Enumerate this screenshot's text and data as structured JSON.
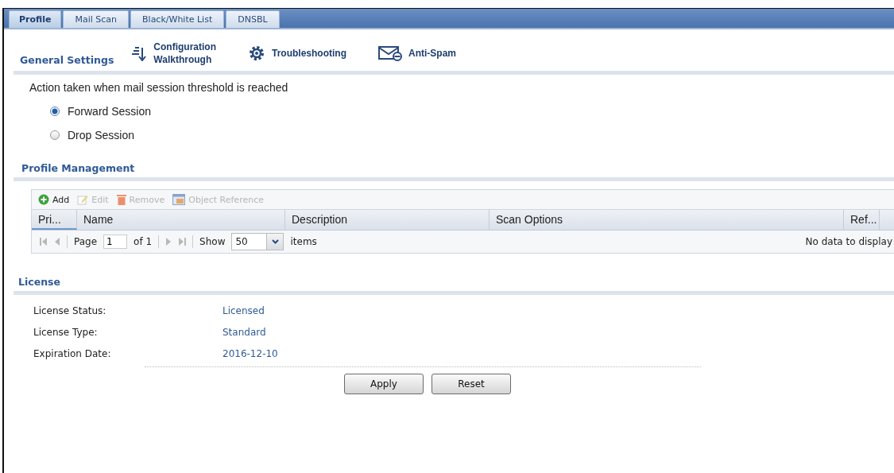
{
  "tabs": [
    {
      "label": "Profile",
      "selected": true
    },
    {
      "label": "Mail Scan",
      "selected": false
    },
    {
      "label": "Black/White List",
      "selected": false
    },
    {
      "label": "DNSBL",
      "selected": false
    }
  ],
  "general_settings": {
    "title": "General Settings",
    "links": [
      {
        "kind": "walkthrough",
        "lines": [
          "Configuration",
          "Walkthrough"
        ]
      },
      {
        "kind": "troubleshooting",
        "lines": [
          "Troubleshooting"
        ]
      },
      {
        "kind": "antispam",
        "lines": [
          "Anti-Spam"
        ]
      }
    ],
    "prompt": "Action taken when mail session threshold is reached",
    "options": [
      {
        "label": "Forward Session",
        "selected": true
      },
      {
        "label": "Drop Session",
        "selected": false
      }
    ]
  },
  "profile_management": {
    "title": "Profile Management",
    "toolbar": [
      {
        "kind": "add",
        "label": "Add",
        "disabled": false
      },
      {
        "kind": "edit",
        "label": "Edit",
        "disabled": true
      },
      {
        "kind": "remove",
        "label": "Remove",
        "disabled": true
      },
      {
        "kind": "reference",
        "label": "Object Reference",
        "disabled": true
      }
    ],
    "columns": [
      "Pri...",
      "Name",
      "Description",
      "Scan Options",
      "Ref..."
    ],
    "pager": {
      "page_label": "Page",
      "page": "1",
      "of": "of 1",
      "show_label": "Show",
      "show": "50",
      "items_label": "items",
      "empty": "No data to display"
    }
  },
  "license": {
    "title": "License",
    "rows": [
      {
        "label": "License Status:",
        "value": "Licensed"
      },
      {
        "label": "License Type:",
        "value": "Standard"
      },
      {
        "label": "Expiration Date:",
        "value": "2016-12-10"
      }
    ]
  },
  "buttons": [
    "Apply",
    "Reset"
  ]
}
